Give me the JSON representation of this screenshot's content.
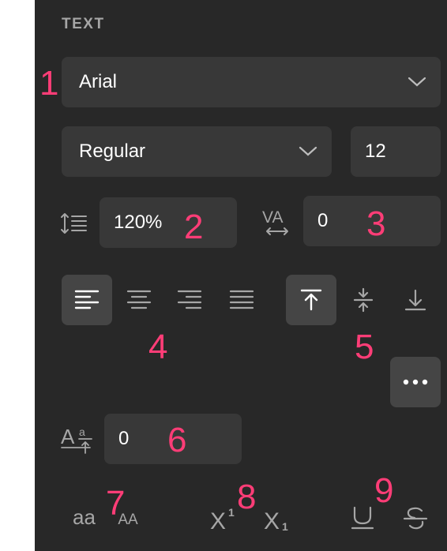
{
  "section_title": "TEXT",
  "font_family": {
    "value": "Arial"
  },
  "font_style": {
    "value": "Regular"
  },
  "font_size": {
    "value": "12"
  },
  "line_height": {
    "value": "120%"
  },
  "letter_spacing": {
    "value": "0"
  },
  "paragraph_spacing": {
    "value": "0"
  },
  "text_case": {
    "lower": "aa",
    "upper": "AA"
  },
  "annotations": [
    "1",
    "2",
    "3",
    "4",
    "5",
    "6",
    "7",
    "8",
    "9"
  ],
  "colors": {
    "panel": "#282828",
    "field": "#383838",
    "active": "#454545",
    "annotation": "#ff3d77",
    "icon": "#a6a6a6"
  }
}
